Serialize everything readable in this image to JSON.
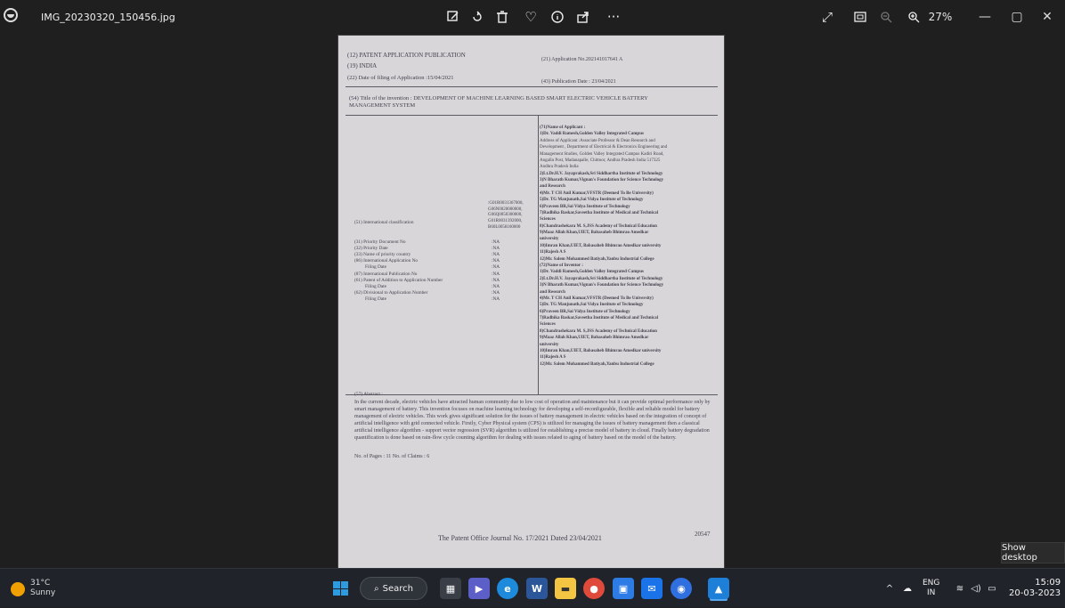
{
  "titlebar": {
    "filename": "IMG_20230320_150456.jpg",
    "toolbar_icons": [
      "edit-icon",
      "rotate-icon",
      "delete-icon",
      "favorite-icon",
      "info-icon",
      "share-icon",
      "more-icon"
    ],
    "zoom": "27%"
  },
  "document": {
    "pub_header": "(12) PATENT APPLICATION PUBLICATION",
    "app_no": "(21) Application No.202141017641 A",
    "country": "(19) INDIA",
    "filing_date": "(22) Date of filing of Application :15/04/2021",
    "pub_date": "(43) Publication Date : 23/04/2021",
    "title_line1": "(54) Title of the invention : DEVELOPMENT OF MACHINE LEARNING BASED SMART ELECTRIC VEHICLE BATTERY",
    "title_line2": "MANAGEMENT SYSTEM",
    "left_fields": [
      "(51) International classification",
      "(31) Priority Document No",
      "(32) Priority Date",
      "(33) Name of priority country",
      "(86) International Application No",
      "Filing Date",
      "(87) International Publication No",
      "(61) Patent of Addition to Application Number",
      "Filing Date",
      "(62) Divisional to Application Number",
      "Filing Date"
    ],
    "classification": [
      ":G01R0031367000,",
      "G06N0020000000,",
      "G06Q0050300000,",
      "G01R0031392000,",
      "B60L0058160000"
    ],
    "na_values": [
      ":NA",
      ":NA",
      ":NA",
      ":NA",
      ":NA",
      ":NA",
      ":NA",
      ":NA",
      ":NA",
      ":NA"
    ],
    "applicant_lines": [
      "(71)Name of Applicant :",
      "1)Dr. Vaddi Ramesh,Golden Valley Integrated Campus",
      "Address of Applicant :Associate Professor & Dean Research and",
      "Development , Department of Electrical & Electronics Engineering and",
      "Management Studies, Golden Valley Integrated Campus Kadiri Road,",
      "Angallu Post, Madanapalle, Chittoor, Andhra Pradesh India 517325",
      "Andhra Pradesh India",
      "2)Lt.Dr.H.V. Jayaprakash,Sri Siddhartha Institute of Technology",
      "3)N Bharath Kumar,Vignan's Foundation for Science Technology",
      "and Research",
      "4)Mr. T CH Anil Kumar,VFSTR (Deemed To Be University)",
      "5)Dr. TG Manjunath,Sai Vidya Institute of Technology",
      "6)Praveen BR,Sai Vidya Institute of Technology",
      "7)Radhika Baskar,Saveetha Institute of Medical and Technical",
      "Sciences",
      "8)Chandrashekara M. S,JSS Academy of Technical Education",
      "9)Maaz Allah Khan,UIET, Babasaheb Bhimrao Amedkar",
      "university",
      "10)Imran Khan,UIET, Babasaheb Bhimrao Amedkar university",
      "11)Rajesh A S",
      "12)Mr. Salem Mohammed Batiyah,Yanbu Industrial College",
      "(72)Name of Inventor :",
      "1)Dr. Vaddi Ramesh,Golden Valley Integrated Campus",
      "2)Lt.Dr.H.V. Jayaprakash,Sri Siddhartha Institute of Technology",
      "3)N Bharath Kumar,Vignan's Foundation for Science Technology",
      "and Research",
      "4)Mr. T CH Anil Kumar,VFSTR (Deemed To Be University)",
      "5)Dr. TG Manjunath,Sai Vidya Institute of Technology",
      "6)Praveen BR,Sai Vidya Institute of Technology",
      "7)Radhika Baskar,Saveetha Institute of Medical and Technical",
      "Sciences",
      "8)Chandrashekara M. S,JSS Academy of Technical Education",
      "9)Maaz Allah Khan,UIET, Babasaheb Bhimrao Amedkar",
      "university",
      "10)Imran Khan,UIET, Babasaheb Bhimrao Amedkar university",
      "11)Rajesh A S",
      "12)Mr. Salem Mohammed Batiyah,Yanbu Industrial College"
    ],
    "abstract_label": "(57) Abstract :",
    "abstract": "In the current decade, electric vehicles have attracted human community due to low cost of operation and maintenance but it can provide optimal performance only by smart management of battery. This invention focuses on machine learning technology for developing a self-reconfigurable, flexible and reliable model for battery management of electric vehicles. This work gives significant solution for the issues of battery management in electric vehicles based on the integration of concept of artificial intelligence with grid connected vehicle. Firstly, Cyber Physical system (CPS) is utilized for managing the issues of battery management then a classical artificial intelligence algorithm - support vector regression (SVR) algorithm is utilized for establishing a precise model of battery in cloud. Finally battery degradation quantification is done based on rain-flow cycle counting algorithm for dealing with issues related to aging of battery based on the model of the battery.",
    "pages_claims": "No. of Pages : 11 No. of Claims : 6",
    "footer_journal": "The Patent Office Journal No. 17/2021 Dated 23/04/2021",
    "page_no": "20547"
  },
  "tooltip": "Show desktop",
  "taskbar": {
    "temp": "31°C",
    "condition": "Sunny",
    "search_label": "Search",
    "lang_top": "ENG",
    "lang_bottom": "IN",
    "time": "15:09",
    "date": "20-03-2023"
  }
}
